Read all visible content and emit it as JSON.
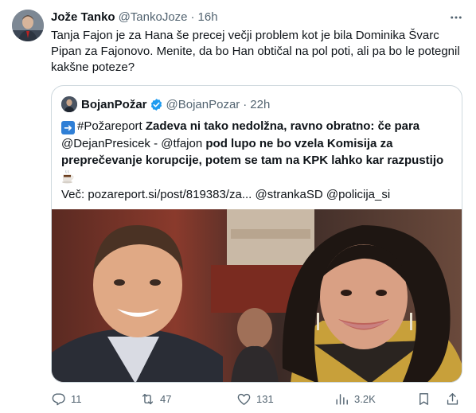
{
  "tweet": {
    "display_name": "Jože Tanko",
    "handle": "@TankoJoze",
    "separator": "·",
    "time": "16h",
    "text": "Tanja Fajon je za Hana še precej večji problem kot je bila Dominika Švarc Pipan za Fajonovo. Menite, da bo Han obtičal na pol poti, ali pa bo le potegnil kakšne poteze?"
  },
  "quote": {
    "display_name": "BojanPožar",
    "handle": "@BojanPozar",
    "separator": "·",
    "time": "22h",
    "text": {
      "hashtag": "#Požareport",
      "bold_1": "Zadeva ni tako nedolžna, ravno obratno: če para",
      "mention_1": "@DejanPresicek",
      "dash": " - ",
      "mention_2": "@tfajon",
      "bold_2": "pod lupo ne bo vzela Komisija za preprečevanje korupcije, potem se tam na KPK lahko kar razpustijo",
      "link_line": "Več: pozareport.si/post/819383/za... @strankaSD @policija_si"
    }
  },
  "actions": {
    "reply_count": "11",
    "retweet_count": "47",
    "like_count": "131",
    "view_count": "3.2K"
  },
  "colors": {
    "verified": "#1d9bf0",
    "muted": "#536471",
    "border": "#cfd9de"
  },
  "icons": [
    "more-icon",
    "verified-badge-icon",
    "arrow-right-emoji",
    "coffee-emoji",
    "reply-icon",
    "retweet-icon",
    "like-icon",
    "views-icon",
    "bookmark-icon",
    "share-icon"
  ]
}
